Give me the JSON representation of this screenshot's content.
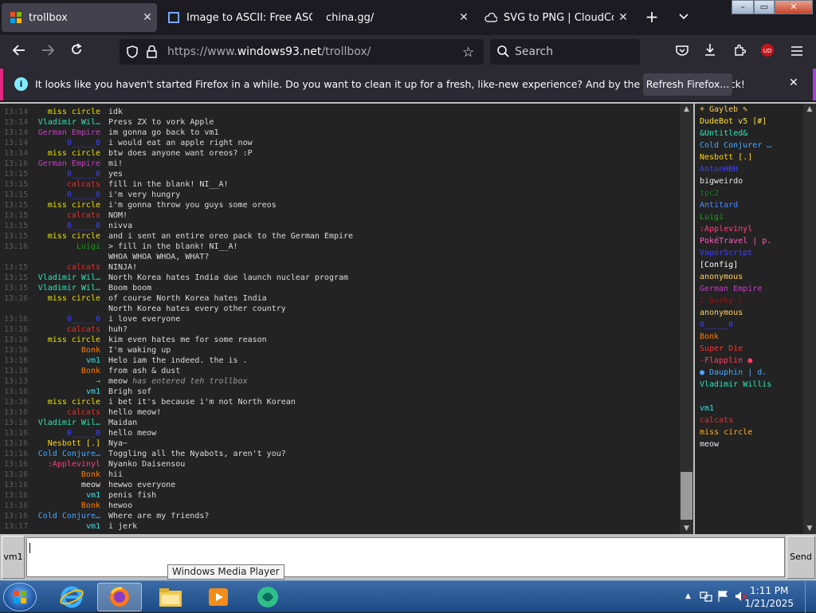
{
  "browser": {
    "tabs": [
      {
        "label": "trollbox",
        "active": true
      },
      {
        "label": "Image to ASCII: Free ASCII",
        "active": false
      },
      {
        "label": "china.gg/",
        "active": false
      },
      {
        "label": "SVG to PNG | CloudConvert",
        "active": false
      }
    ],
    "url_prefix": "https://www.",
    "url_domain": "windows93.net",
    "url_path": "/trollbox/",
    "search_placeholder": "Search",
    "notification": "It looks like you haven't started Firefox in a while. Do you want to clean it up for a fresh, like-new experience? And by the way, welcome back!",
    "notification_button": "Refresh Firefox..."
  },
  "trollbox": {
    "messages": [
      {
        "time": "13:14",
        "nick": "miss circle",
        "color": "#e8e000",
        "text": "idk"
      },
      {
        "time": "13:14",
        "nick": "Vladimir Wil…",
        "color": "#2ee6b8",
        "text": "Press ZX to vork Apple"
      },
      {
        "time": "13:14",
        "nick": "German Empire",
        "color": "#c040c0",
        "text": "im gonna go back to vm1"
      },
      {
        "time": "13:14",
        "nick": "0_____0",
        "color": "#4040ff",
        "text": "i would eat an apple right now"
      },
      {
        "time": "13:14",
        "nick": "miss circle",
        "color": "#e8e000",
        "text": "btw does anyone want oreos? :P"
      },
      {
        "time": "13:16",
        "nick": "German Empire",
        "color": "#c040c0",
        "text": "mi!"
      },
      {
        "time": "13:15",
        "nick": "0_____0",
        "color": "#4040ff",
        "text": "yes"
      },
      {
        "time": "13:15",
        "nick": "calcats",
        "color": "#e03030",
        "text": "fill in the blank! NI__A!"
      },
      {
        "time": "13:15",
        "nick": "0_____0",
        "color": "#4040ff",
        "text": "i'm very hungry"
      },
      {
        "time": "13:15",
        "nick": "miss circle",
        "color": "#e8e000",
        "text": "i'm gonna throw you guys some oreos"
      },
      {
        "time": "13:15",
        "nick": "calcats",
        "color": "#e03030",
        "text": "NOM!"
      },
      {
        "time": "13:15",
        "nick": "0_____0",
        "color": "#4040ff",
        "text": "nivva"
      },
      {
        "time": "13:15",
        "nick": "miss circle",
        "color": "#e8e000",
        "text": "and i sent an entire oreo pack to the German Empire"
      },
      {
        "time": "13:16",
        "nick": "Luigi",
        "color": "#1a9a1a",
        "text": "> fill in the blank! NI__A!"
      },
      {
        "time": "",
        "nick": "",
        "color": "#dcdcdc",
        "text": "WHOA WHOA WHOA, WHAT?"
      },
      {
        "time": "13:15",
        "nick": "calcats",
        "color": "#e03030",
        "text": "NINJA!"
      },
      {
        "time": "13:15",
        "nick": "Vladimir Wil…",
        "color": "#2ee6b8",
        "text": "North Korea hates India due launch nuclear program"
      },
      {
        "time": "13:15",
        "nick": "Vladimir Wil…",
        "color": "#2ee6b8",
        "text": "Boom boom"
      },
      {
        "time": "13:16",
        "nick": "miss circle",
        "color": "#e8e000",
        "text": "of course North Korea hates India"
      },
      {
        "time": "",
        "nick": "",
        "color": "#dcdcdc",
        "text": "North Korea hates every other country"
      },
      {
        "time": "13:16",
        "nick": "0_____0",
        "color": "#4040ff",
        "text": "i love everyone"
      },
      {
        "time": "13:16",
        "nick": "calcats",
        "color": "#e03030",
        "text": "huh?"
      },
      {
        "time": "13:16",
        "nick": "miss circle",
        "color": "#e8e000",
        "text": "kim even hates me for some reason"
      },
      {
        "time": "13:16",
        "nick": "Bonk",
        "color": "#ff7a00",
        "text": "I'm waking up"
      },
      {
        "time": "13:16",
        "nick": "vm1",
        "color": "#2ee6e6",
        "text": "Helo iam the indeed. the is ."
      },
      {
        "time": "13:18",
        "nick": "Bonk",
        "color": "#ff7a00",
        "text": "from ash & dust"
      },
      {
        "time": "13:13",
        "nick": "→",
        "color": "#2ee62e",
        "text": "meow",
        "italic": "has entered teh trollbox"
      },
      {
        "time": "13:16",
        "nick": "vm1",
        "color": "#2ee6e6",
        "text": "Brigh sof"
      },
      {
        "time": "13:16",
        "nick": "miss circle",
        "color": "#e8e000",
        "text": "i bet it's because i'm not North Korean"
      },
      {
        "time": "13:16",
        "nick": "calcats",
        "color": "#e03030",
        "text": "hello meow!"
      },
      {
        "time": "13:16",
        "nick": "Vladimir Wil…",
        "color": "#2ee6b8",
        "text": "Maidan"
      },
      {
        "time": "13:16",
        "nick": "0_____0",
        "color": "#4040ff",
        "text": "hello meow"
      },
      {
        "time": "13:16",
        "nick": "Nesbott [.]",
        "color": "#ffd700",
        "text": "Nya~"
      },
      {
        "time": "13:16",
        "nick": "Cold Conjure…",
        "color": "#4aa8ff",
        "text": "Toggling all the Nyabots, aren't you?"
      },
      {
        "time": "13:16",
        "nick": ":Applevinyl",
        "color": "#ff4080",
        "text": "Nyanko Daisensou"
      },
      {
        "time": "13:16",
        "nick": "Bonk",
        "color": "#ff7a00",
        "text": "hii"
      },
      {
        "time": "13:16",
        "nick": "meow",
        "color": "#e6e6e6",
        "text": "hewwo everyone"
      },
      {
        "time": "13:16",
        "nick": "vm1",
        "color": "#2ee6e6",
        "text": "penis fish"
      },
      {
        "time": "13:16",
        "nick": "Bonk",
        "color": "#ff7a00",
        "text": "hewoo"
      },
      {
        "time": "13:16",
        "nick": "Cold Conjure…",
        "color": "#4aa8ff",
        "text": "Where are my friends?"
      },
      {
        "time": "13:17",
        "nick": "vm1",
        "color": "#2ee6e6",
        "text": "i jerk"
      }
    ],
    "users": [
      {
        "name": "☀ Gayleb ✎",
        "color": "#ffd060"
      },
      {
        "name": "DudeBot v5 [#]",
        "color": "#ffe040"
      },
      {
        "name": "&Untitled&",
        "color": "#2ee6b8"
      },
      {
        "name": "Cold Conjurer …",
        "color": "#4aa8ff"
      },
      {
        "name": "Nesbott [.]",
        "color": "#ffd700"
      },
      {
        "name": "AntonHBH",
        "color": "#4040ff"
      },
      {
        "name": "bigweirdo",
        "color": "#e6e6e6"
      },
      {
        "name": "tpc2",
        "color": "#1a7a1a"
      },
      {
        "name": "Antitard",
        "color": "#4a8aff"
      },
      {
        "name": "Luigi",
        "color": "#1a9a1a"
      },
      {
        "name": ":Applevinyl",
        "color": "#ff4080"
      },
      {
        "name": "PokéTravel | p.",
        "color": "#ff60c0"
      },
      {
        "name": "VaporScript",
        "color": "#4040ff"
      },
      {
        "name": "[Config]",
        "color": "#ffffff"
      },
      {
        "name": "anonymous",
        "color": "#ffd060"
      },
      {
        "name": "German Empire",
        "color": "#c040c0"
      },
      {
        "name": "♪ Gorky ♪",
        "color": "#a01010"
      },
      {
        "name": "anonymous",
        "color": "#ffd060"
      },
      {
        "name": "0_____0",
        "color": "#4040ff"
      },
      {
        "name": "Bonk",
        "color": "#ff7a00"
      },
      {
        "name": "Super Die",
        "color": "#ff3030"
      },
      {
        "name": "-Flapplin ●",
        "color": "#ff4060"
      },
      {
        "name": "● Dauphin | d.",
        "color": "#4aa8ff"
      },
      {
        "name": "Vladimir Willis",
        "color": "#2ee6b8"
      },
      {
        "name": " ",
        "color": "#ffffff"
      },
      {
        "name": "vm1",
        "color": "#2ee6e6"
      },
      {
        "name": "calcats",
        "color": "#e03030"
      },
      {
        "name": "miss circle",
        "color": "#ffb020"
      },
      {
        "name": "meow",
        "color": "#e6e6e6"
      }
    ],
    "current_nick": "vm1",
    "input_value": "",
    "send_label": "Send"
  },
  "tooltip": "Windows Media Player",
  "taskbar": {
    "time": "1:11 PM",
    "date": "1/21/2025"
  }
}
